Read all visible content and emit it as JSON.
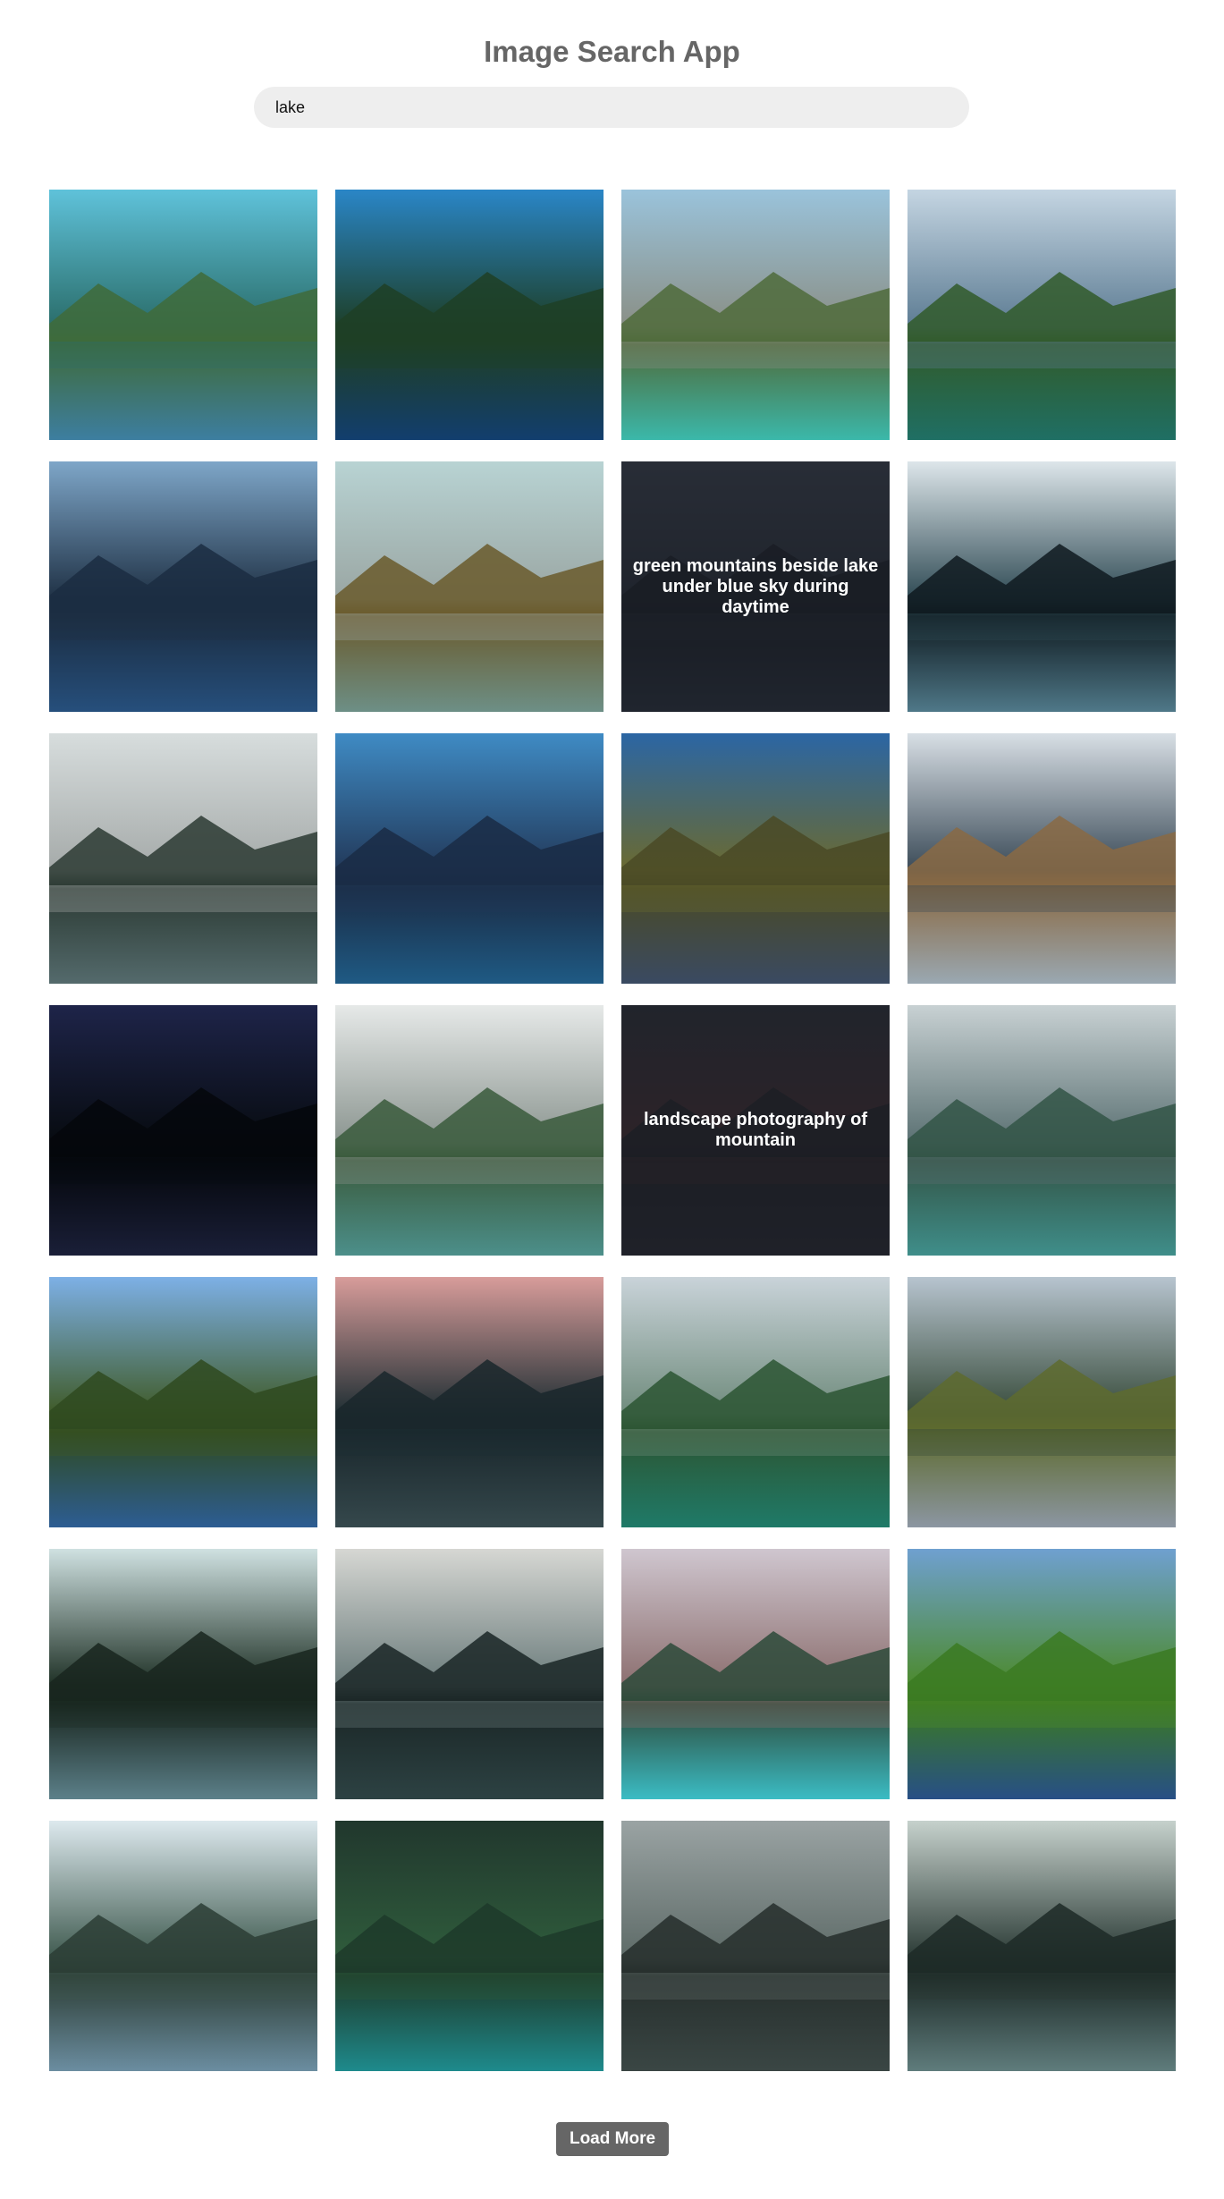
{
  "header": {
    "title": "Image Search App"
  },
  "search": {
    "value": "lake",
    "placeholder": ""
  },
  "results": [
    {
      "photo": "lake-mountains-clouds",
      "sky": "#5fc2da",
      "far": "#2a6d6a",
      "ground": "#3f6b3a",
      "water": "#3d7ea0",
      "caption": ""
    },
    {
      "photo": "wooden-dock-lake",
      "sky": "#2a86c7",
      "far": "#1d3f28",
      "ground": "#1f3f26",
      "water": "#123e6e",
      "caption": ""
    },
    {
      "photo": "turquoise-lake-boat",
      "sky": "#9ac3db",
      "far": "#8a8f86",
      "ground": "#4f6b3b",
      "water": "#3bb8aa",
      "caption": ""
    },
    {
      "photo": "forest-lake-mountains",
      "sky": "#c4d5e2",
      "far": "#5d7c93",
      "ground": "#315b2a",
      "water": "#1f6f64",
      "caption": ""
    },
    {
      "photo": "calm-blue-lake",
      "sky": "#7ea6c8",
      "far": "#1f3145",
      "ground": "#1b2d42",
      "water": "#264f7c",
      "caption": ""
    },
    {
      "photo": "pine-forest-lake",
      "sky": "#b8d3d3",
      "far": "#9aa6a3",
      "ground": "#6a5a2c",
      "water": "#6d8f86",
      "caption": ""
    },
    {
      "photo": "mountains-beside-lake",
      "sky": "#4a5463",
      "far": "#2b3340",
      "ground": "#141a22",
      "water": "#2c3746",
      "caption": "green mountains beside lake under blue sky during daytime"
    },
    {
      "photo": "misty-lake-hills",
      "sky": "#dde6ea",
      "far": "#2f4a54",
      "ground": "#0f1a20",
      "water": "#4f7888",
      "caption": ""
    },
    {
      "photo": "snowy-mountain-lake",
      "sky": "#d7dddd",
      "far": "#a5aaa9",
      "ground": "#2b3a33",
      "water": "#546a6c",
      "caption": ""
    },
    {
      "photo": "deep-blue-lake",
      "sky": "#3f8bc4",
      "far": "#22395a",
      "ground": "#1a2c45",
      "water": "#1f5a84",
      "caption": ""
    },
    {
      "photo": "sunset-lake-island",
      "sky": "#2b66a4",
      "far": "#6b6a30",
      "ground": "#4a4a26",
      "water": "#3a4a62",
      "caption": ""
    },
    {
      "photo": "reeds-by-lake",
      "sky": "#d8dfe5",
      "far": "#3a4a57",
      "ground": "#8a6a44",
      "water": "#9aa8b2",
      "caption": ""
    },
    {
      "photo": "starry-night-lake",
      "sky": "#1e2449",
      "far": "#070b10",
      "ground": "#05070c",
      "water": "#1a1f38",
      "caption": ""
    },
    {
      "photo": "boat-mountain-lake",
      "sky": "#e6e9e8",
      "far": "#8b9590",
      "ground": "#3a5a3c",
      "water": "#4c8f8a",
      "caption": ""
    },
    {
      "photo": "mountain-lake-photography",
      "sky": "#2f323d",
      "far": "#5a3030",
      "ground": "#1d1d23",
      "water": "#2a2a33",
      "caption": "landscape photography of mountain"
    },
    {
      "photo": "clear-alpine-lake",
      "sky": "#c8d1d3",
      "far": "#5b7173",
      "ground": "#335547",
      "water": "#3f8e8a",
      "caption": ""
    },
    {
      "photo": "autumn-forest-lake",
      "sky": "#7db0e6",
      "far": "#3f5a26",
      "ground": "#2f4a20",
      "water": "#2d5d93",
      "caption": ""
    },
    {
      "photo": "pink-sunset-lake",
      "sky": "#d89c9a",
      "far": "#1e2e33",
      "ground": "#1a272c",
      "water": "#35484c",
      "caption": ""
    },
    {
      "photo": "green-valley-lake",
      "sky": "#c9d3d9",
      "far": "#6f8b7c",
      "ground": "#2c5532",
      "water": "#1f7a68",
      "caption": ""
    },
    {
      "photo": "grassy-shore-lake",
      "sky": "#b7c4cf",
      "far": "#374b3a",
      "ground": "#5e6b2f",
      "water": "#8c96a2",
      "caption": ""
    },
    {
      "photo": "sunrise-tree-line-lake",
      "sky": "#cfe1e1",
      "far": "#1d2f24",
      "ground": "#19261f",
      "water": "#5c8089",
      "caption": ""
    },
    {
      "photo": "foggy-still-lake",
      "sky": "#d6d7d3",
      "far": "#6a7b7b",
      "ground": "#1a2626",
      "water": "#2d4243",
      "caption": ""
    },
    {
      "photo": "canoe-turquoise-lake",
      "sky": "#cfc6cf",
      "far": "#8c6f6f",
      "ground": "#2d4a3a",
      "water": "#3bbcc4",
      "caption": ""
    },
    {
      "photo": "green-hills-lake",
      "sky": "#6fa0d0",
      "far": "#4c8a2c",
      "ground": "#3b7a22",
      "water": "#274f86",
      "caption": ""
    },
    {
      "photo": "long-pier-lake",
      "sky": "#dde9ee",
      "far": "#3f5a4f",
      "ground": "#2c3d35",
      "water": "#6b8da0",
      "caption": ""
    },
    {
      "photo": "evergreen-forest-lake",
      "sky": "#21372d",
      "far": "#2f5c3c",
      "ground": "#1d3a2a",
      "water": "#1e8a8c",
      "caption": ""
    },
    {
      "photo": "misty-mountain-lake",
      "sky": "#9aa3a3",
      "far": "#5e6b68",
      "ground": "#262e2c",
      "water": "#3a4644",
      "caption": ""
    },
    {
      "photo": "misty-island-lake",
      "sky": "#c6d1cc",
      "far": "#2a3a35",
      "ground": "#1d2a27",
      "water": "#5f7c7c",
      "caption": ""
    }
  ],
  "actions": {
    "load_more_label": "Load More"
  }
}
